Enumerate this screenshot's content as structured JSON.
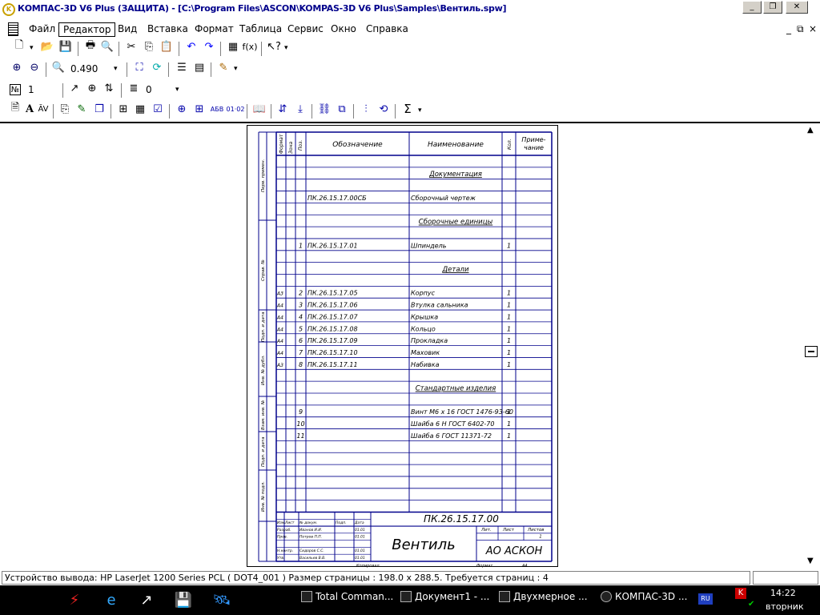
{
  "window": {
    "title": "КОМПАС-3D V6 Plus (ЗАЩИТА) - [C:\\Program Files\\ASCON\\KOMPAS-3D V6 Plus\\Samples\\Вентиль.spw]",
    "icon": "kompas-app-icon"
  },
  "menu": {
    "items": [
      "Файл",
      "Редактор",
      "Вид",
      "Вставка",
      "Формат",
      "Таблица",
      "Сервис",
      "Окно",
      "Справка"
    ],
    "active": "Редактор",
    "mdi": [
      "_",
      "⧉",
      "×"
    ]
  },
  "toolbar": {
    "zoom": "0.490",
    "number_label": "№",
    "number_value": "1",
    "level_value": "0"
  },
  "spec": {
    "header": {
      "format": "Формат",
      "zone": "Зона",
      "pos": "Поз.",
      "designation": "Обозначение",
      "name": "Наименование",
      "qty": "Кол.",
      "note": "Приме- чание"
    },
    "rows": [
      {
        "format": "",
        "pos": "",
        "designation": "",
        "name": "",
        "qty": "",
        "section": false
      },
      {
        "format": "",
        "pos": "",
        "designation": "",
        "name": "Документация",
        "qty": "",
        "section": true
      },
      {
        "format": "",
        "pos": "",
        "designation": "",
        "name": "",
        "qty": "",
        "section": false
      },
      {
        "format": "",
        "pos": "",
        "designation": "ПК.26.15.17.00СБ",
        "name": "Сборочный чертеж",
        "qty": "",
        "section": false
      },
      {
        "format": "",
        "pos": "",
        "designation": "",
        "name": "",
        "qty": "",
        "section": false
      },
      {
        "format": "",
        "pos": "",
        "designation": "",
        "name": "Сборочные единицы",
        "qty": "",
        "section": true
      },
      {
        "format": "",
        "pos": "",
        "designation": "",
        "name": "",
        "qty": "",
        "section": false
      },
      {
        "format": "",
        "pos": "1",
        "designation": "ПК.26.15.17.01",
        "name": "Шпиндель",
        "qty": "1",
        "section": false
      },
      {
        "format": "",
        "pos": "",
        "designation": "",
        "name": "",
        "qty": "",
        "section": false
      },
      {
        "format": "",
        "pos": "",
        "designation": "",
        "name": "Детали",
        "qty": "",
        "section": true
      },
      {
        "format": "",
        "pos": "",
        "designation": "",
        "name": "",
        "qty": "",
        "section": false
      },
      {
        "format": "А3",
        "pos": "2",
        "designation": "ПК.26.15.17.05",
        "name": "Корпус",
        "qty": "1",
        "section": false
      },
      {
        "format": "А4",
        "pos": "3",
        "designation": "ПК.26.15.17.06",
        "name": "Втулка сальника",
        "qty": "1",
        "section": false
      },
      {
        "format": "А4",
        "pos": "4",
        "designation": "ПК.26.15.17.07",
        "name": "Крышка",
        "qty": "1",
        "section": false
      },
      {
        "format": "А4",
        "pos": "5",
        "designation": "ПК.26.15.17.08",
        "name": "Кольцо",
        "qty": "1",
        "section": false
      },
      {
        "format": "А4",
        "pos": "6",
        "designation": "ПК.26.15.17.09",
        "name": "Прокладка",
        "qty": "1",
        "section": false
      },
      {
        "format": "А4",
        "pos": "7",
        "designation": "ПК.26.15.17.10",
        "name": "Маховик",
        "qty": "1",
        "section": false
      },
      {
        "format": "А3",
        "pos": "8",
        "designation": "ПК.26.15.17.11",
        "name": "Набивка",
        "qty": "1",
        "section": false
      },
      {
        "format": "",
        "pos": "",
        "designation": "",
        "name": "",
        "qty": "",
        "section": false
      },
      {
        "format": "",
        "pos": "",
        "designation": "",
        "name": "Стандартные изделия",
        "qty": "",
        "section": true
      },
      {
        "format": "",
        "pos": "",
        "designation": "",
        "name": "",
        "qty": "",
        "section": false
      },
      {
        "format": "",
        "pos": "9",
        "designation": "",
        "name": "Винт М6 х 16 ГОСТ 1476-93-60",
        "qty": "1",
        "section": false
      },
      {
        "format": "",
        "pos": "10",
        "designation": "",
        "name": "Шайба 6 Н ГОСТ 6402-70",
        "qty": "1",
        "section": false
      },
      {
        "format": "",
        "pos": "11",
        "designation": "",
        "name": "Шайба 6 ГОСТ 11371-72",
        "qty": "1",
        "section": false
      },
      {
        "format": "",
        "pos": "",
        "designation": "",
        "name": "",
        "qty": "",
        "section": false
      },
      {
        "format": "",
        "pos": "",
        "designation": "",
        "name": "",
        "qty": "",
        "section": false
      },
      {
        "format": "",
        "pos": "",
        "designation": "",
        "name": "",
        "qty": "",
        "section": false
      },
      {
        "format": "",
        "pos": "",
        "designation": "",
        "name": "",
        "qty": "",
        "section": false
      },
      {
        "format": "",
        "pos": "",
        "designation": "",
        "name": "",
        "qty": "",
        "section": false
      },
      {
        "format": "",
        "pos": "",
        "designation": "",
        "name": "",
        "qty": "",
        "section": false
      }
    ],
    "side_labels": [
      "Перв. примен.",
      "Справ. №",
      "Подп. и дата",
      "Инв. № дубл.",
      "Взам. инв. №",
      "Подп. и дата",
      "Инв. № подл."
    ],
    "stamp": {
      "doc_number": "ПК.26.15.17.00",
      "name": "Вентиль",
      "org": "АО АСКОН",
      "head": [
        "Изм.",
        "Лист",
        "№ докум.",
        "Подп.",
        "Дата"
      ],
      "roles": [
        {
          "role": "Разраб.",
          "person": "Иванов И.И.",
          "date": "01.01"
        },
        {
          "role": "Пров.",
          "person": "Петров П.П.",
          "date": "01.01"
        },
        {
          "role": "",
          "person": "",
          "date": ""
        },
        {
          "role": "Н.контр.",
          "person": "Сидоров С.С.",
          "date": "01.01"
        },
        {
          "role": "Утв.",
          "person": "Васильев В.В.",
          "date": "01.01"
        }
      ],
      "lit": "Лит.",
      "sheet": "Лист",
      "sheets": "Листов",
      "sheets_value": "1",
      "copied": "Копировал",
      "format_label": "Формат",
      "format_value": "А4"
    }
  },
  "status": {
    "text": "Устройство вывода: HP LaserJet 1200 Series PCL ( DOT4_001 )  Размер страницы : 198.0 x 288.5.  Требуется страниц : 4"
  },
  "taskbar": {
    "tasks": [
      "Total Comman...",
      "Документ1 - ...",
      "Двухмерное ...",
      "КОМПАС-3D ..."
    ],
    "lang": "RU",
    "time": "14:22",
    "day": "вторник"
  },
  "colors": {
    "spec_lines": "#00008b",
    "titlebar_text": "#00008b",
    "taskbar": "#000000"
  }
}
